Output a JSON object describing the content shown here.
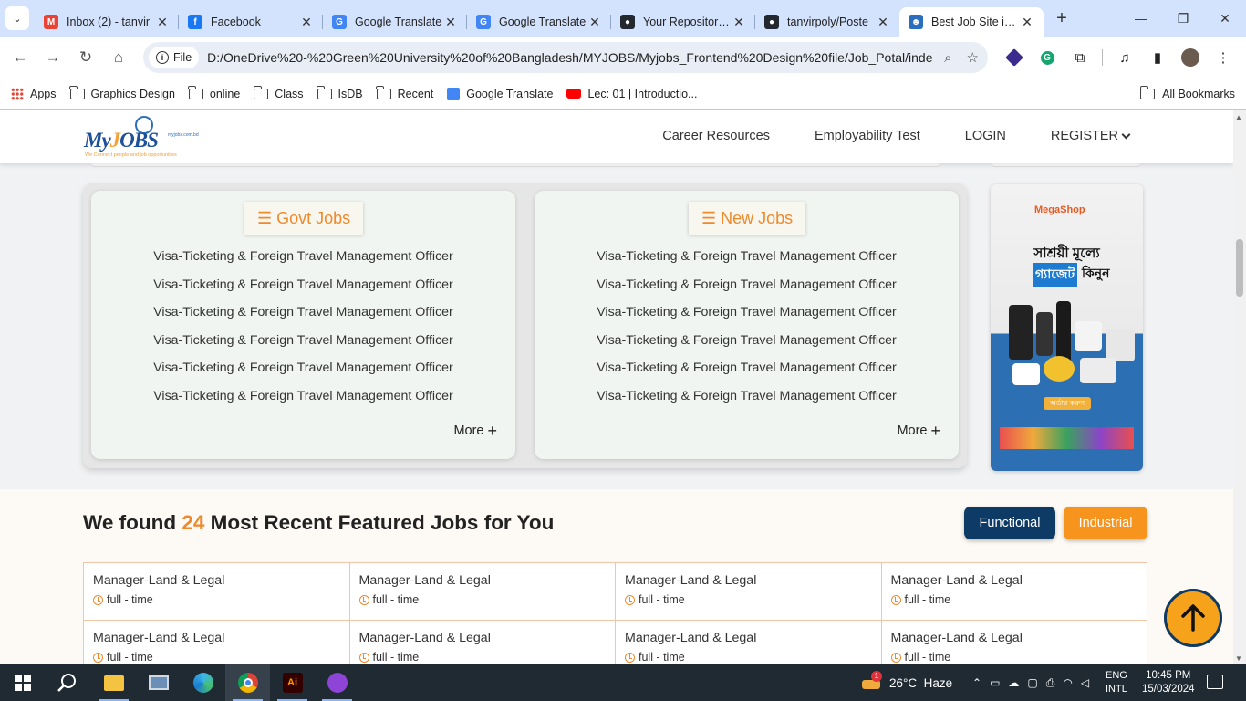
{
  "browser": {
    "tabs": [
      {
        "title": "Inbox (2) - tanvir",
        "icon": "gmail-icon",
        "color": "#ea4335",
        "glyph": "M"
      },
      {
        "title": "Facebook",
        "icon": "facebook-icon",
        "color": "#1877f2",
        "glyph": "f"
      },
      {
        "title": "Google Translate",
        "icon": "google-translate-icon",
        "color": "#4285f4",
        "glyph": "G"
      },
      {
        "title": "Google Translate",
        "icon": "google-translate-icon",
        "color": "#4285f4",
        "glyph": "G"
      },
      {
        "title": "Your Repositories",
        "icon": "github-icon",
        "color": "#24292f",
        "glyph": "●"
      },
      {
        "title": "tanvirpoly/Poste",
        "icon": "github-icon",
        "color": "#24292f",
        "glyph": "●"
      },
      {
        "title": "Best Job Site in B",
        "icon": "myjobs-favicon",
        "color": "#2a6fbf",
        "glyph": "☻",
        "active": true
      }
    ],
    "new_tab": "+",
    "file_chip": "File",
    "url": "D:/OneDrive%20-%20Green%20University%20of%20Bangladesh/MYJOBS/Myjobs_Frontend%20Design%20file/Job_Potal/index...",
    "bookmarks": [
      {
        "label": "Apps",
        "icon": "apps-grid-icon"
      },
      {
        "label": "Graphics Design",
        "icon": "folder-icon"
      },
      {
        "label": "online",
        "icon": "folder-icon"
      },
      {
        "label": "Class",
        "icon": "folder-icon"
      },
      {
        "label": "IsDB",
        "icon": "folder-icon"
      },
      {
        "label": "Recent",
        "icon": "folder-icon"
      },
      {
        "label": "Google Translate",
        "icon": "google-translate-icon"
      },
      {
        "label": "Lec: 01 | Introductio...",
        "icon": "youtube-icon"
      }
    ],
    "all_bookmarks": "All Bookmarks"
  },
  "site": {
    "logo": {
      "text_a": "My",
      "text_b": "J",
      "text_c": "OBS",
      "tagline": "We Connect people and job opportunities",
      "domain": "myjobs.com.bd"
    },
    "nav": {
      "career": "Career Resources",
      "test": "Employability Test",
      "login": "LOGIN",
      "register": "REGISTER"
    },
    "govt": {
      "title": "Govt Jobs",
      "jobs": [
        "Visa-Ticketing & Foreign Travel Management Officer",
        "Visa-Ticketing & Foreign Travel Management Officer",
        "Visa-Ticketing & Foreign Travel Management Officer",
        "Visa-Ticketing & Foreign Travel Management Officer",
        "Visa-Ticketing & Foreign Travel Management Officer",
        "Visa-Ticketing & Foreign Travel Management Officer"
      ],
      "more": "More"
    },
    "new": {
      "title": "New Jobs",
      "jobs": [
        "Visa-Ticketing & Foreign Travel Management Officer",
        "Visa-Ticketing & Foreign Travel Management Officer",
        "Visa-Ticketing & Foreign Travel Management Officer",
        "Visa-Ticketing & Foreign Travel Management Officer",
        "Visa-Ticketing & Foreign Travel Management Officer",
        "Visa-Ticketing & Foreign Travel Management Officer"
      ],
      "more": "More"
    },
    "ad": {
      "brand": "MegaShop",
      "line1": "সাশ্রয়ী মূল্যে",
      "line2a": "গ্যাজেট",
      "line2b": "কিনুন",
      "order": "অর্ডার করুন"
    },
    "featured": {
      "prefix": "We found",
      "count": "24",
      "suffix": "Most Recent Featured Jobs for You",
      "functional": "Functional",
      "industrial": "Industrial",
      "jobs": [
        {
          "title": "Manager-Land & Legal",
          "type": "full - time"
        },
        {
          "title": "Manager-Land & Legal",
          "type": "full - time"
        },
        {
          "title": "Manager-Land & Legal",
          "type": "full - time"
        },
        {
          "title": "Manager-Land & Legal",
          "type": "full - time"
        },
        {
          "title": "Manager-Land & Legal",
          "type": "full - time"
        },
        {
          "title": "Manager-Land & Legal",
          "type": "full - time"
        },
        {
          "title": "Manager-Land & Legal",
          "type": "full - time"
        },
        {
          "title": "Manager-Land & Legal",
          "type": "full - time"
        }
      ]
    }
  },
  "taskbar": {
    "weather": "26°C  Haze",
    "weather_badge": "1",
    "lang1": "ENG",
    "lang2": "INTL",
    "time": "10:45 PM",
    "date": "15/03/2024"
  },
  "colors": {
    "accent": "#f0892a",
    "navy": "#0d3b66",
    "orange": "#f7941d"
  }
}
